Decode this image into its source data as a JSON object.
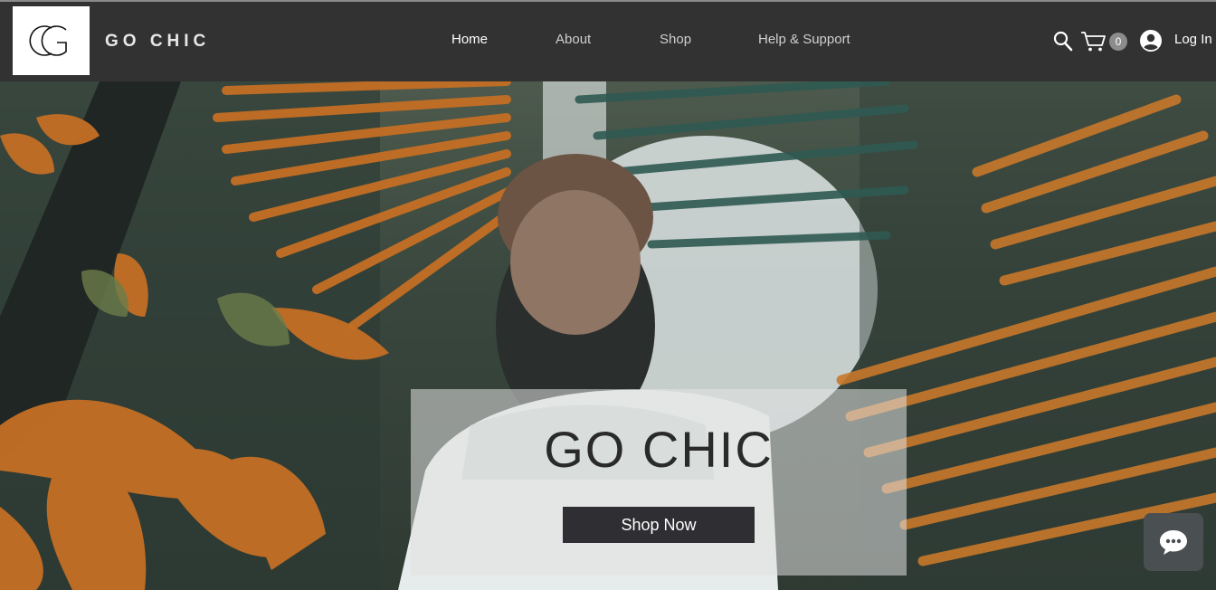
{
  "header": {
    "brand": "GO CHIC",
    "logo_monogram": "GC",
    "nav": [
      {
        "label": "Home",
        "active": true
      },
      {
        "label": "About",
        "active": false
      },
      {
        "label": "Shop",
        "active": false
      },
      {
        "label": "Help & Support",
        "active": false
      }
    ],
    "cart_count": "0",
    "login_label": "Log In"
  },
  "hero": {
    "title": "GO CHIC",
    "cta_label": "Shop Now"
  },
  "icons": {
    "search": "search-icon",
    "cart": "cart-icon",
    "user": "user-avatar-icon",
    "chat": "chat-icon"
  },
  "colors": {
    "header_bg": "#323232",
    "button_bg": "#2f2f33",
    "foliage_orange": "#c8782a",
    "foliage_green": "#2f5a52"
  }
}
